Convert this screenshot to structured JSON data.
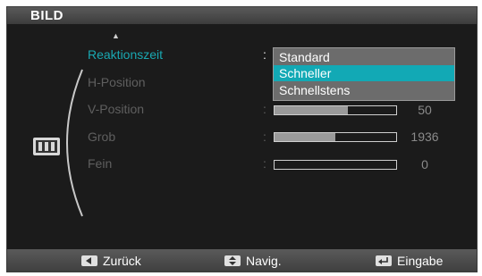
{
  "title": "BILD",
  "menu": {
    "items": [
      {
        "label": "Reaktionszeit",
        "active": true
      },
      {
        "label": "H-Position"
      },
      {
        "label": "V-Position"
      },
      {
        "label": "Grob"
      },
      {
        "label": "Fein"
      }
    ],
    "colon": ":",
    "sliders": [
      {
        "value": "50",
        "fraction": 0.6
      },
      {
        "value": "1936",
        "fraction": 0.5
      },
      {
        "value": "0",
        "fraction": 0.0
      }
    ]
  },
  "dropdown": {
    "options": [
      "Standard",
      "Schneller",
      "Schnellstens"
    ],
    "selected": "Schneller"
  },
  "footer": {
    "back_label": "Zurück",
    "nav_label": "Navig.",
    "enter_label": "Eingabe"
  },
  "colors": {
    "accent": "#12a9b5",
    "active_text": "#19a8b2",
    "background": "#1b1b1b"
  },
  "icons": [
    "up-arrow-icon",
    "picture-menu-icon",
    "left-arrow-key-icon",
    "up-down-key-icon",
    "enter-key-icon"
  ]
}
